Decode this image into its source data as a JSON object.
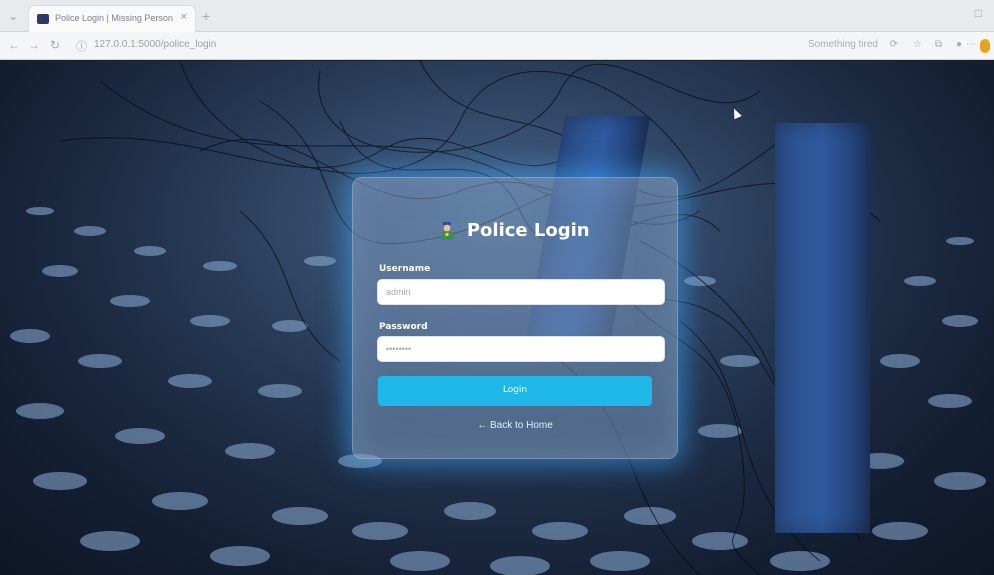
{
  "browser": {
    "tab_title": "Police Login | Missing Person Syst",
    "tab_close": "×",
    "new_tab": "+",
    "url": "127.0.0.1:5000/police_login",
    "profile_label": "Something tired"
  },
  "login": {
    "title": "Police Login",
    "username_label": "Username",
    "username_value": "admin",
    "password_label": "Password",
    "password_value": "••••••••",
    "login_button": "Login",
    "back_link": "← Back to Home"
  },
  "colors": {
    "accent": "#1eb7e8",
    "card_glow": "#3caaff"
  }
}
